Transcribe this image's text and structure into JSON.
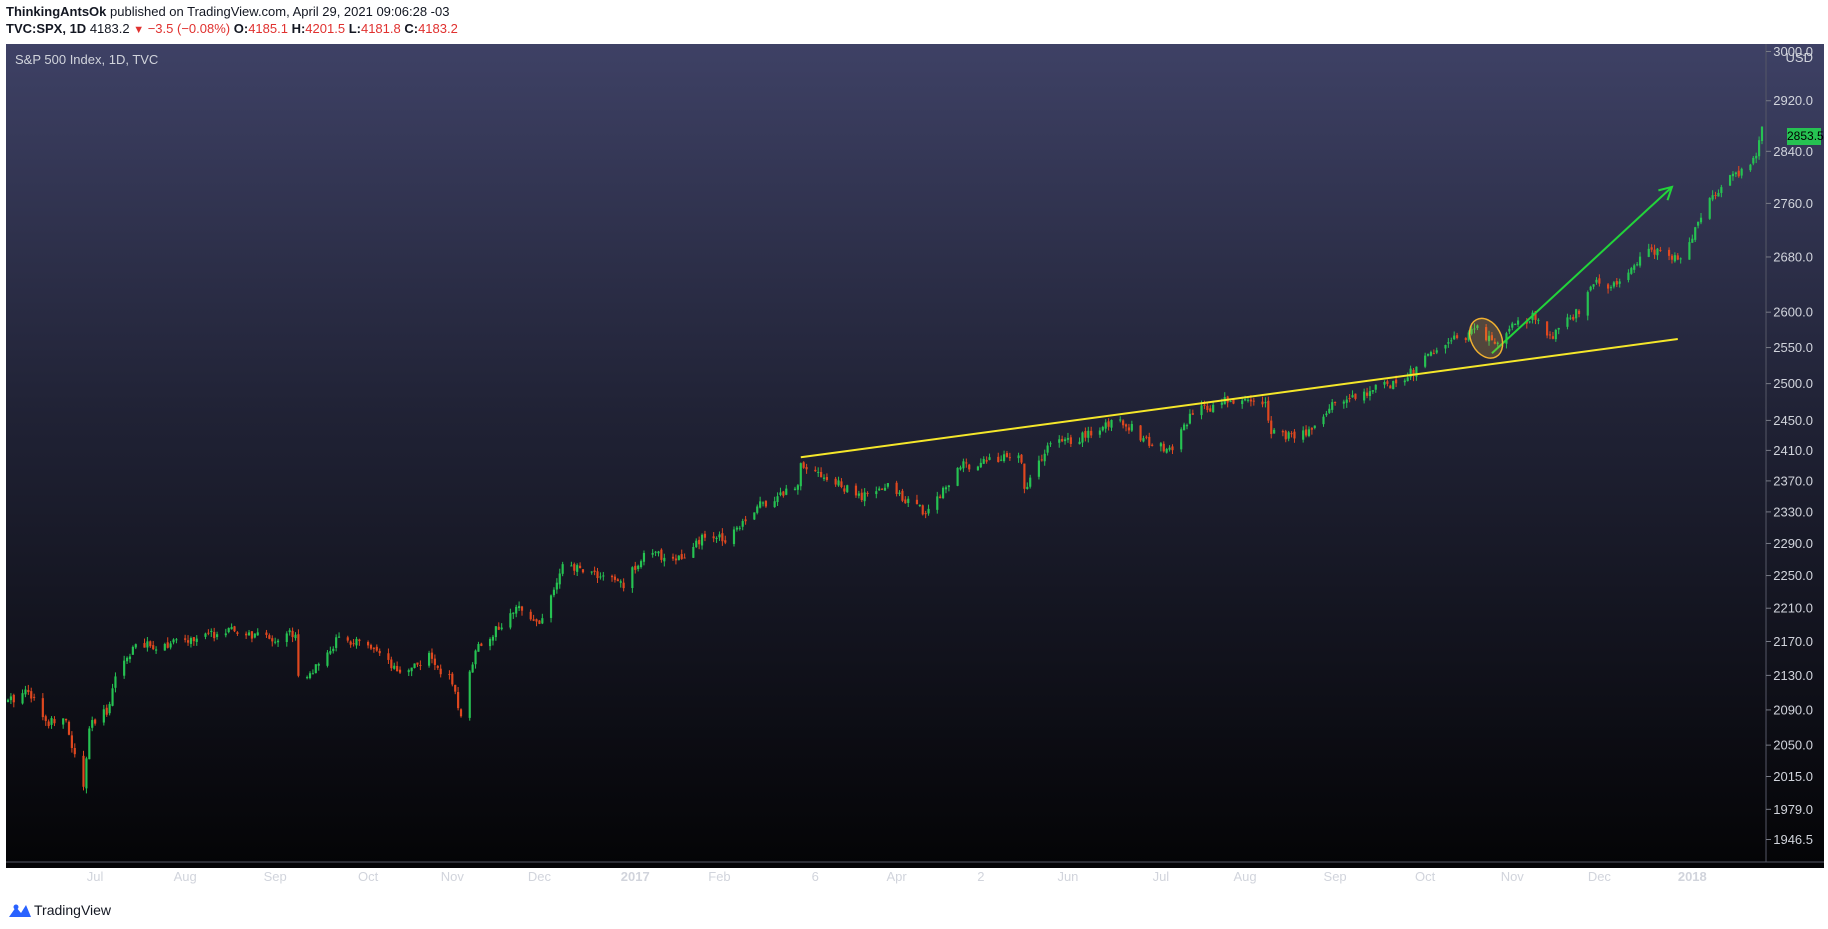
{
  "header": {
    "author": "ThinkingAntsOk",
    "published": "published on TradingView.com, April 29, 2021 09:06:28 -03",
    "symbol": "TVC:SPX, 1D",
    "last": "4183.2",
    "down_arrow": "▼",
    "change": "−3.5 (−0.08%)",
    "open_label": "O:",
    "open": "4185.1",
    "high_label": "H:",
    "high": "4201.5",
    "low_label": "L:",
    "low": "4181.8",
    "close_label": "C:",
    "close": "4183.2"
  },
  "legend": {
    "title": "S&P 500 Index, 1D, TVC"
  },
  "price_axis": {
    "currency": "USD",
    "last_price_tag": "2853.5",
    "last_price_color": "#26c252"
  },
  "footer": {
    "brand": "TradingView"
  },
  "colors": {
    "up": "#26c252",
    "down": "#e0481f",
    "trendline": "#f5e72a",
    "arrow": "#22d43a",
    "highlight": "#f0b030"
  },
  "chart_data": {
    "type": "candlestick",
    "title": "S&P 500 Index, 1D, TVC",
    "y_unit": "USD",
    "y_scale": "log",
    "ylim": [
      1920,
      3010
    ],
    "y_ticks": [
      3000.0,
      2920.0,
      2840.0,
      2760.0,
      2680.0,
      2600.0,
      2550.0,
      2500.0,
      2450.0,
      2410.0,
      2370.0,
      2330.0,
      2290.0,
      2250.0,
      2210.0,
      2170.0,
      2130.0,
      2090.0,
      2050.0,
      2015.0,
      1979.0,
      1946.5
    ],
    "y_tick_labels": [
      "3000.0",
      "2920.0",
      "2840.0",
      "2760.0",
      "2680.0",
      "2600.0",
      "2550.0",
      "2500.0",
      "2450.0",
      "2410.0",
      "2370.0",
      "2330.0",
      "2290.0",
      "2250.0",
      "2210.0",
      "2170.0",
      "2130.0",
      "2090.0",
      "2050.0",
      "2015.0",
      "1979.0",
      "1946.5"
    ],
    "xlim": [
      "2016-06-01",
      "2018-01-26"
    ],
    "x_ticks": [
      {
        "label": "Jul",
        "date": "2016-07-01",
        "bold": false
      },
      {
        "label": "Aug",
        "date": "2016-08-01",
        "bold": false
      },
      {
        "label": "Sep",
        "date": "2016-09-01",
        "bold": false
      },
      {
        "label": "Oct",
        "date": "2016-10-03",
        "bold": false
      },
      {
        "label": "Nov",
        "date": "2016-11-01",
        "bold": false
      },
      {
        "label": "Dec",
        "date": "2016-12-01",
        "bold": false
      },
      {
        "label": "2017",
        "date": "2017-01-03",
        "bold": true
      },
      {
        "label": "Feb",
        "date": "2017-02-01",
        "bold": false
      },
      {
        "label": "6",
        "date": "2017-03-06",
        "bold": false
      },
      {
        "label": "Apr",
        "date": "2017-04-03",
        "bold": false
      },
      {
        "label": "2",
        "date": "2017-05-02",
        "bold": false
      },
      {
        "label": "Jun",
        "date": "2017-06-01",
        "bold": false
      },
      {
        "label": "Jul",
        "date": "2017-07-03",
        "bold": false
      },
      {
        "label": "Aug",
        "date": "2017-08-01",
        "bold": false
      },
      {
        "label": "Sep",
        "date": "2017-09-01",
        "bold": false
      },
      {
        "label": "Oct",
        "date": "2017-10-02",
        "bold": false
      },
      {
        "label": "Nov",
        "date": "2017-11-01",
        "bold": false
      },
      {
        "label": "Dec",
        "date": "2017-12-01",
        "bold": false
      },
      {
        "label": "2018",
        "date": "2018-01-02",
        "bold": true
      }
    ],
    "price_path": [
      [
        "2016-06-01",
        2099
      ],
      [
        "2016-06-08",
        2115
      ],
      [
        "2016-06-14",
        2075
      ],
      [
        "2016-06-20",
        2085
      ],
      [
        "2016-06-24",
        2037
      ],
      [
        "2016-06-27",
        2000
      ],
      [
        "2016-06-29",
        2070
      ],
      [
        "2016-07-05",
        2088
      ],
      [
        "2016-07-08",
        2130
      ],
      [
        "2016-07-14",
        2163
      ],
      [
        "2016-07-21",
        2165
      ],
      [
        "2016-08-01",
        2170
      ],
      [
        "2016-08-10",
        2178
      ],
      [
        "2016-08-16",
        2182
      ],
      [
        "2016-08-24",
        2177
      ],
      [
        "2016-09-01",
        2173
      ],
      [
        "2016-09-08",
        2182
      ],
      [
        "2016-09-09",
        2128
      ],
      [
        "2016-09-16",
        2139
      ],
      [
        "2016-09-22",
        2171
      ],
      [
        "2016-09-30",
        2168
      ],
      [
        "2016-10-07",
        2153
      ],
      [
        "2016-10-13",
        2132
      ],
      [
        "2016-10-24",
        2151
      ],
      [
        "2016-10-31",
        2126
      ],
      [
        "2016-11-04",
        2085
      ],
      [
        "2016-11-09",
        2163
      ],
      [
        "2016-11-15",
        2180
      ],
      [
        "2016-11-25",
        2213
      ],
      [
        "2016-12-01",
        2191
      ],
      [
        "2016-12-09",
        2259
      ],
      [
        "2016-12-16",
        2258
      ],
      [
        "2016-12-30",
        2239
      ],
      [
        "2017-01-06",
        2277
      ],
      [
        "2017-01-20",
        2271
      ],
      [
        "2017-01-26",
        2296
      ],
      [
        "2017-02-03",
        2297
      ],
      [
        "2017-02-14",
        2337
      ],
      [
        "2017-02-28",
        2364
      ],
      [
        "2017-03-01",
        2396
      ],
      [
        "2017-03-10",
        2373
      ],
      [
        "2017-03-22",
        2348
      ],
      [
        "2017-03-31",
        2363
      ],
      [
        "2017-04-13",
        2329
      ],
      [
        "2017-04-25",
        2388
      ],
      [
        "2017-05-05",
        2399
      ],
      [
        "2017-05-16",
        2400
      ],
      [
        "2017-05-17",
        2357
      ],
      [
        "2017-05-25",
        2415
      ],
      [
        "2017-06-09",
        2432
      ],
      [
        "2017-06-19",
        2453
      ],
      [
        "2017-06-29",
        2419
      ],
      [
        "2017-07-06",
        2410
      ],
      [
        "2017-07-14",
        2459
      ],
      [
        "2017-07-26",
        2478
      ],
      [
        "2017-08-08",
        2474
      ],
      [
        "2017-08-10",
        2438
      ],
      [
        "2017-08-18",
        2425
      ],
      [
        "2017-08-25",
        2443
      ],
      [
        "2017-09-01",
        2476
      ],
      [
        "2017-09-11",
        2488
      ],
      [
        "2017-09-22",
        2502
      ],
      [
        "2017-09-29",
        2519
      ],
      [
        "2017-10-06",
        2549
      ],
      [
        "2017-10-20",
        2575
      ],
      [
        "2017-10-25",
        2557
      ],
      [
        "2017-10-31",
        2575
      ],
      [
        "2017-11-08",
        2594
      ],
      [
        "2017-11-15",
        2565
      ],
      [
        "2017-11-24",
        2602
      ],
      [
        "2017-11-30",
        2647
      ],
      [
        "2017-12-07",
        2636
      ],
      [
        "2017-12-18",
        2690
      ],
      [
        "2017-12-29",
        2673
      ],
      [
        "2018-01-05",
        2743
      ],
      [
        "2018-01-12",
        2786
      ],
      [
        "2018-01-19",
        2810
      ],
      [
        "2018-01-24",
        2837
      ],
      [
        "2018-01-26",
        2873
      ]
    ],
    "annotations": [
      {
        "type": "trendline",
        "from": [
          "2017-03-01",
          2401
        ],
        "to": [
          "2017-12-28",
          2562
        ]
      },
      {
        "type": "arrow",
        "from": [
          "2017-10-25",
          2542
        ],
        "to": [
          "2017-12-26",
          2785
        ]
      },
      {
        "type": "ellipse",
        "center": [
          "2017-10-23",
          2563
        ]
      }
    ]
  }
}
